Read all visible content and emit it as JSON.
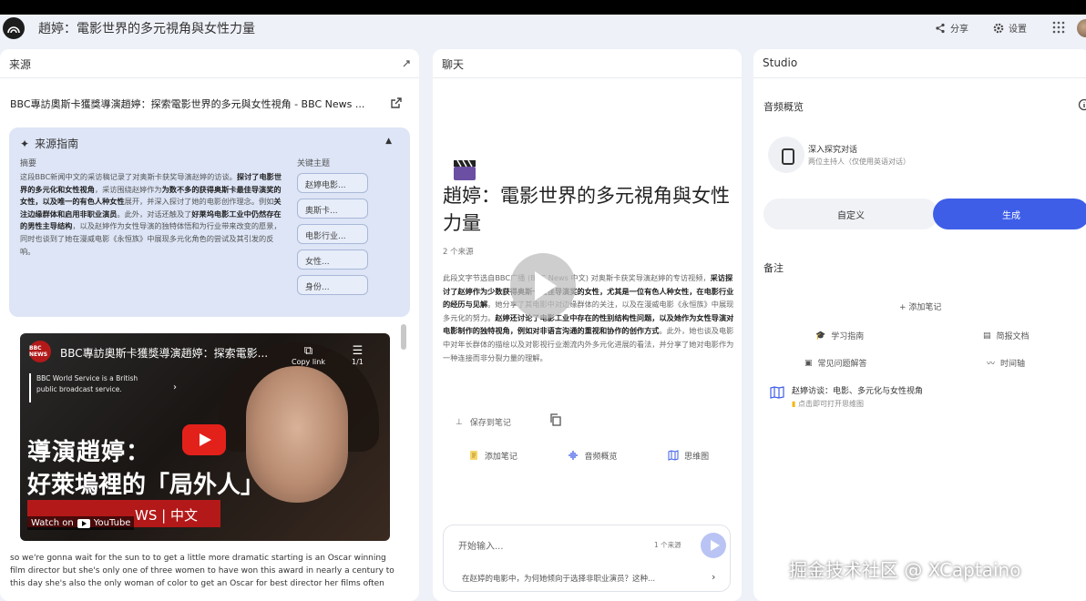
{
  "header": {
    "title": "趙婷：電影世界的多元視角與女性力量",
    "share_label": "分享",
    "settings_label": "设置"
  },
  "sources": {
    "panel_title": "来源",
    "source_title": "BBC專訪奧斯卡獲獎導演趙婷：探索電影世界的多元與女性視角 - BBC News ...",
    "guide": {
      "title": "来源指南",
      "summary_label": "摘要",
      "topics_label": "关键主题",
      "summary_parts": [
        {
          "text": "这段BBC新闻中文的采访稿记录了对奥斯卡获奖导演赵婷的访谈。",
          "bold": false
        },
        {
          "text": "探讨了电影世界的多元化和女性视角",
          "bold": true
        },
        {
          "text": "，采访围绕赵婷作为",
          "bold": false
        },
        {
          "text": "为数不多的获得奥斯卡最佳导演奖的女性，以及唯一的有色人种女性",
          "bold": true
        },
        {
          "text": "展开，并深入探讨了她的电影创作理念。例如",
          "bold": false
        },
        {
          "text": "关注边缘群体和启用非职业演员",
          "bold": true
        },
        {
          "text": "。此外，对话还触及了",
          "bold": false
        },
        {
          "text": "好莱坞电影工业中仍然存在的男性主导结构",
          "bold": true
        },
        {
          "text": "，以及赵婷作为女性导演的独特体悟和为行业带来改变的愿景，同时也谈到了她在漫威电影《永恒族》中展现多元化角色的尝试及其引发的反响。",
          "bold": false
        }
      ],
      "topics": [
        "赵婷电影...",
        "奥斯卡...",
        "电影行业...",
        "女性...",
        "身份..."
      ]
    },
    "video": {
      "channel": "BBC NEWS",
      "title": "BBC專訪奧斯卡獲獎導演趙婷：探索電影...",
      "copy_link": "Copy link",
      "playlist_count": "1/1",
      "info_line1": "BBC World Service is a British",
      "info_line2": "public broadcast service.",
      "overlay_line1": "導演趙婷：",
      "overlay_line2": "好萊塢裡的「局外人」",
      "band_text": "WS | 中文",
      "watch_on": "Watch on",
      "youtube": "YouTube"
    },
    "transcript": "so we're gonna wait for the sun to to get a little more dramatic starting is an Oscar winning film director but she's only one of three women to have won this award in nearly a century to this day she's also the only woman of color to get an Oscar for best director her films often"
  },
  "chat": {
    "panel_title": "聊天",
    "title": "趙婷：電影世界的多元視角與女性力量",
    "source_count": "2 个来源",
    "body_parts": [
      {
        "text": "此段文字节选自BBC广播 (BBC News 中文) 对奥斯卡获奖导演赵婷的专访视频，",
        "bold": false
      },
      {
        "text": "采访探讨了赵婷作为少数获得奥斯卡最佳导演奖的女性，尤其是一位有色人种女性，在电影行业的经历与见解",
        "bold": true
      },
      {
        "text": "。她分享了其电影中对边缘群体的关注，以及在漫威电影《永恒族》中展现多元化的努力。",
        "bold": false
      },
      {
        "text": "赵婷还讨论了电影工业中存在的性别结构性问题，以及她作为女性导演对电影制作的独特视角，例如对非语言沟通的重视和协作的创作方式",
        "bold": true
      },
      {
        "text": "。此外，她也谈及电影中对年长群体的描绘以及对影视行业潮流内外多元化进展的看法，并分享了她对电影作为一种连接而非分裂力量的理解。",
        "bold": false
      }
    ],
    "save_note": "保存到笔记",
    "actions": [
      {
        "icon": "note-icon",
        "label": "添加笔记"
      },
      {
        "icon": "audio-icon",
        "label": "音频概览"
      },
      {
        "icon": "mindmap-icon",
        "label": "思维图"
      }
    ],
    "input": {
      "placeholder": "开始输入...",
      "count": "1 个来源",
      "suggestion": "在赵婷的电影中，为何她倾向于选择非职业演员？这种..."
    }
  },
  "studio": {
    "panel_title": "Studio",
    "audio_overview_label": "音频概览",
    "deep_dive_title": "深入探究对话",
    "deep_dive_sub": "两位主持人（仅使用英语对话）",
    "customize_label": "自定义",
    "generate_label": "生成",
    "notes_label": "备注",
    "add_note_label": "+ 添加笔记",
    "tools": [
      {
        "icon": "study-guide-icon",
        "label": "学习指南"
      },
      {
        "icon": "briefing-icon",
        "label": "简报文档"
      },
      {
        "icon": "faq-icon",
        "label": "常见问题解答"
      },
      {
        "icon": "timeline-icon",
        "label": "时间轴"
      }
    ],
    "mindmap_title": "赵婷访谈：电影、多元化与女性视角",
    "mindmap_sub": "点击即可打开思维图"
  },
  "watermark": "掘金技术社区 @ XCaptaino",
  "colors": {
    "accent": "#3e5ee8",
    "guide_bg": "#dde5f6",
    "page_bg": "#eef1f8",
    "youtube_red": "#e3211b",
    "bbc_red": "#b31919"
  }
}
